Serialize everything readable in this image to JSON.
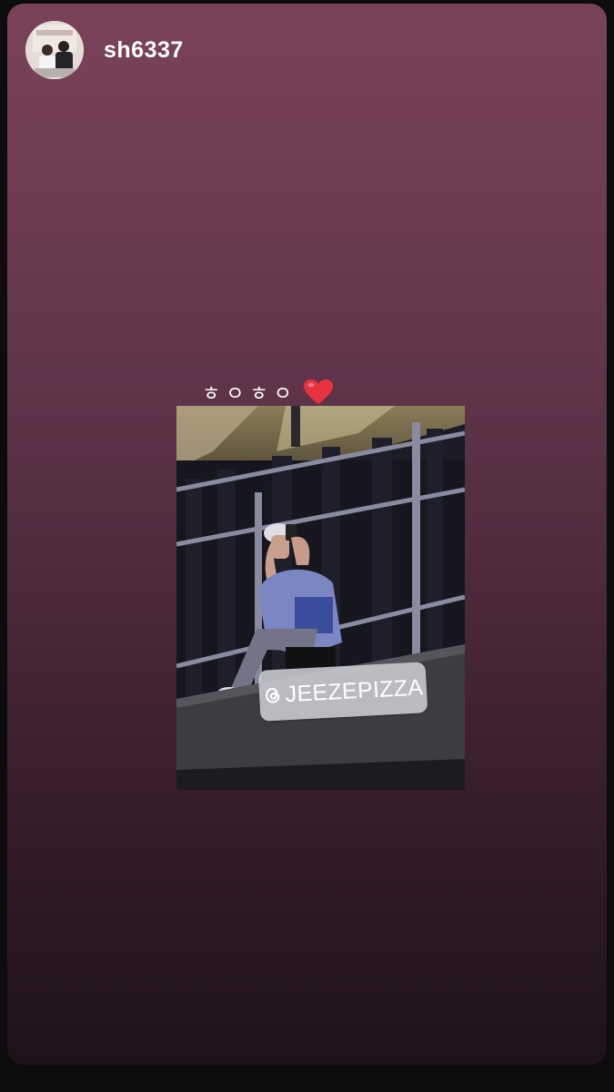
{
  "story": {
    "username": "sh6337",
    "caption": "ㅎㅇㅎㅇ",
    "caption_icon": "red-heart-icon",
    "mention": "JEEZEPIZZA",
    "mention_icon": "threads-at-icon"
  },
  "colors": {
    "gradient_top": "#7a4258",
    "gradient_bottom": "#1f121a",
    "heart": "#e8323f",
    "sticker": "#c8c8ce"
  }
}
